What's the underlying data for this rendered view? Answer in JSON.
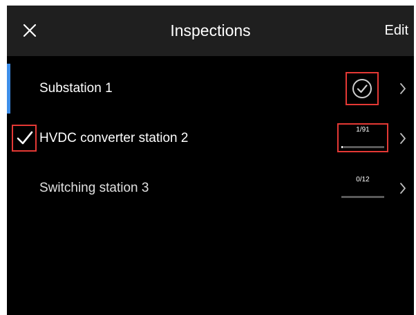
{
  "header": {
    "close_icon": "close-icon",
    "title": "Inspections",
    "edit_label": "Edit",
    "background": "#1f1f1f"
  },
  "colors": {
    "background": "#000000",
    "text_primary": "#ffffff",
    "text_secondary": "#e0e0e0",
    "accent": "#3d8ee9",
    "highlight": "#e53935"
  },
  "inspections": [
    {
      "name": "Substation 1",
      "status": "complete",
      "status_icon": "check-circle-icon",
      "selected": true
    },
    {
      "name": "HVDC converter station 2",
      "progress_text": "1/91",
      "progress_done": 1,
      "progress_total": 91,
      "checked": true,
      "checked_icon": "checkmark-icon"
    },
    {
      "name": "Switching station 3",
      "progress_text": "0/12",
      "progress_done": 0,
      "progress_total": 12
    }
  ]
}
